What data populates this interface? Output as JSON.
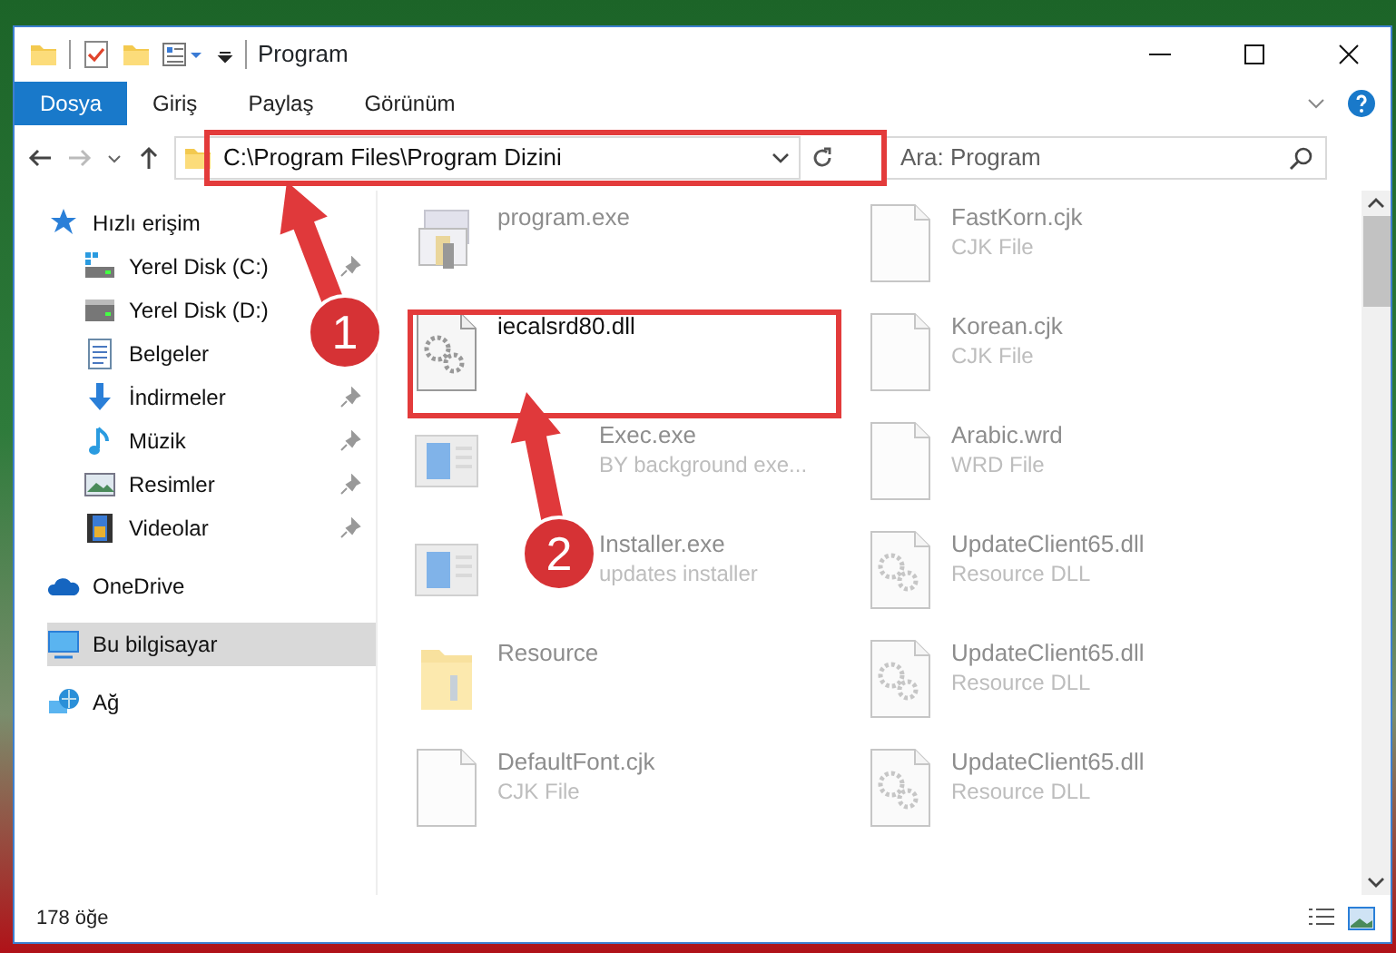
{
  "window": {
    "title": "Program"
  },
  "ribbon_tabs": [
    {
      "label": "Dosya",
      "selected": true
    },
    {
      "label": "Giriş",
      "selected": false
    },
    {
      "label": "Paylaş",
      "selected": false
    },
    {
      "label": "Görünüm",
      "selected": false
    }
  ],
  "address_bar": {
    "path": "C:\\Program Files\\Program Dizini"
  },
  "search": {
    "placeholder": "Ara: Program"
  },
  "sidebar": {
    "items": [
      {
        "label": "Hızlı erişim",
        "kind": "star",
        "selected": false,
        "children": [
          {
            "label": "Yerel Disk (C:)",
            "kind": "drive-win",
            "pinned": true,
            "selected": false
          },
          {
            "label": "Yerel Disk (D:)",
            "kind": "drive",
            "selected": false
          },
          {
            "label": "Belgeler",
            "kind": "docs",
            "selected": false
          },
          {
            "label": "İndirmeler",
            "kind": "download",
            "pinned": true,
            "selected": false
          },
          {
            "label": "Müzik",
            "kind": "music",
            "pinned": true,
            "selected": false
          },
          {
            "label": "Resimler",
            "kind": "pictures",
            "pinned": true,
            "selected": false
          },
          {
            "label": "Videolar",
            "kind": "videos",
            "pinned": true,
            "selected": false
          }
        ]
      },
      {
        "label": "OneDrive",
        "kind": "cloud",
        "selected": false
      },
      {
        "label": "Bu bilgisayar",
        "kind": "computer",
        "selected": true
      },
      {
        "label": "Ağ",
        "kind": "network",
        "selected": false
      }
    ]
  },
  "files": [
    {
      "name": "program.exe",
      "kind": "app",
      "blurred": true
    },
    {
      "name": "FastKorn.cjk",
      "type": "CJK File",
      "kind": "doc",
      "blurred": true
    },
    {
      "name": "iecalsrd80.dll",
      "kind": "dll",
      "blurred": false
    },
    {
      "name": "Korean.cjk",
      "type": "CJK File",
      "kind": "doc",
      "blurred": true
    },
    {
      "name": "Exec.exe",
      "type": "BY background exe...",
      "kind": "window",
      "blurred": true,
      "covered": true
    },
    {
      "name": "Arabic.wrd",
      "type": "WRD File",
      "kind": "doc",
      "blurred": true
    },
    {
      "name": "Installer.exe",
      "type": "updates installer",
      "kind": "window",
      "blurred": true,
      "covered": true
    },
    {
      "name": "UpdateClient65.dll",
      "type": "Resource DLL",
      "kind": "dll",
      "blurred": true
    },
    {
      "name": "Resource",
      "kind": "folder",
      "blurred": true
    },
    {
      "name": "UpdateClient65.dll",
      "type": "Resource DLL",
      "kind": "dll",
      "blurred": true
    },
    {
      "name": "DefaultFont.cjk",
      "type": "CJK File",
      "kind": "doc",
      "blurred": true
    },
    {
      "name": "UpdateClient65.dll",
      "type": "Resource DLL",
      "kind": "dll",
      "blurred": true
    }
  ],
  "annotations": [
    {
      "label": "1"
    },
    {
      "label": "2"
    }
  ],
  "status_bar": {
    "count": "178 öğe"
  }
}
